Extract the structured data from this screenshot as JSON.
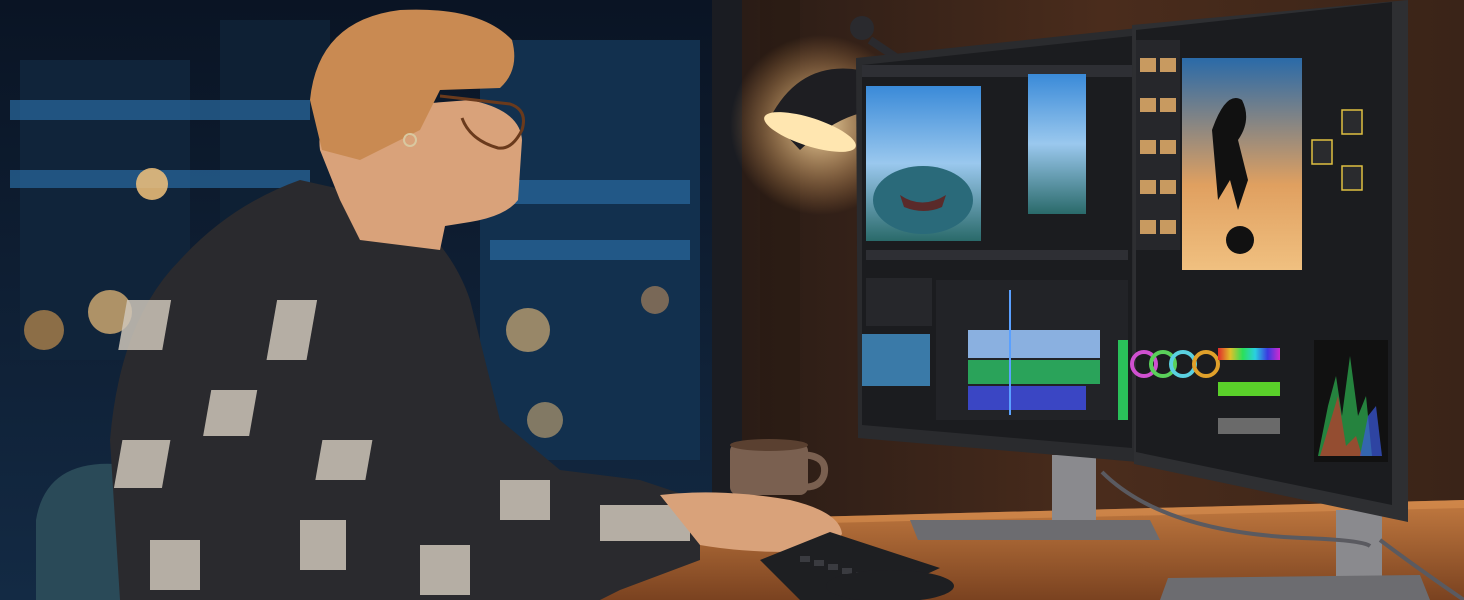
{
  "scene": {
    "subject": "person-editing-video",
    "colors": {
      "night_sky": "#0c1a2e",
      "window_blue": "#1d4e7a",
      "city_light": "#f2c27a",
      "wall_warm": "#3a2418",
      "lamp_glow": "#ffe6b0",
      "desk_wood": "#b06a36",
      "desk_shadow": "#6a3a1c",
      "monitor_bezel": "#2a2b2e",
      "monitor_stand": "#8a8a8e",
      "ui_dark": "#1b1c1f",
      "ui_panel": "#26272b",
      "timeline_green": "#2aa35a",
      "timeline_blue": "#3a46c4",
      "timeline_purple": "#8a6ad0",
      "shirt_dark": "#2a2a2e",
      "shirt_light": "#cfc7ba",
      "skin": "#d9a27a",
      "hair": "#c98a52"
    },
    "icons": [
      "desk-lamp-icon",
      "coffee-mug-icon",
      "keyboard-icon",
      "mouse-icon"
    ]
  }
}
